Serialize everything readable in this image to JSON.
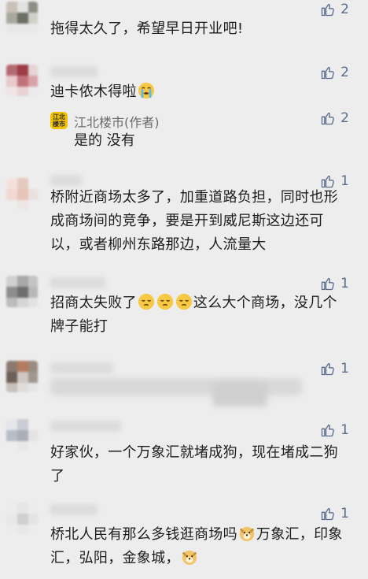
{
  "comments": [
    {
      "text": "拖得太久了，希望早日开业吧!",
      "likes": "2"
    },
    {
      "text": "迪卡侬木得啦",
      "likes": "2",
      "reply": {
        "author": "江北楼市(作者)",
        "badge": "江北楼市",
        "text": "是的 没有",
        "likes": "2"
      }
    },
    {
      "text": "桥附近商场太多了，加重道路负担，同时也形成商场间的竞争，要是开到威尼斯这边还可以，或者柳州东路那边，人流量大",
      "likes": "1"
    },
    {
      "text_a": "招商太失败了",
      "text_b": "这么大个商场，没几个牌子能打",
      "likes": "1"
    },
    {
      "text": "",
      "likes": "1"
    },
    {
      "text": "好家伙，一个万象汇就堵成狗，现在堵成二狗了",
      "likes": "1"
    },
    {
      "text_a": "桥北人民有那么多钱逛商场吗",
      "text_b": "万象汇，印象汇，弘阳，金象城，",
      "likes": "1"
    }
  ],
  "icons": {
    "like": "thumbs-up-icon",
    "emoji_cry": "loudly-crying-face-icon",
    "emoji_sad": "pensive-face-icon",
    "emoji_dog": "dog-face-icon"
  },
  "colors": {
    "background": "#ededed",
    "like": "#5a6c8a",
    "badge": "#f2c200"
  }
}
